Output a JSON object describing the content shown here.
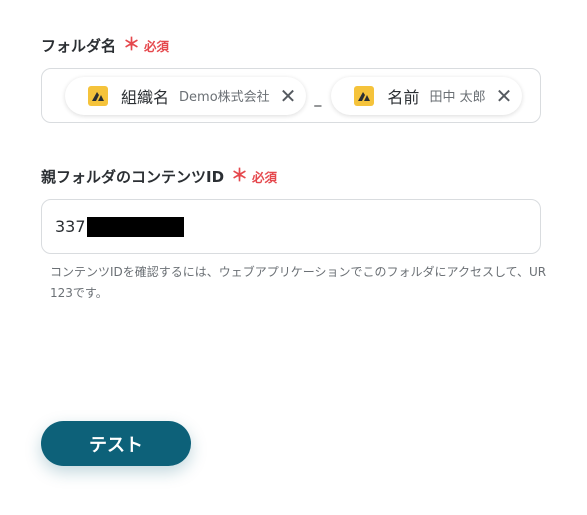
{
  "folder_name_field": {
    "label": "フォルダ名",
    "required_mark": "＊",
    "required_text": "必須",
    "chips": [
      {
        "name": "組織名",
        "value": "Demo株式会社",
        "icon": "app-logo-icon"
      },
      {
        "name": "名前",
        "value": "田中 太郎",
        "icon": "app-logo-icon"
      }
    ],
    "separator": "_"
  },
  "parent_folder_field": {
    "label": "親フォルダのコンテンツID",
    "required_mark": "＊",
    "required_text": "必須",
    "value_visible": "337",
    "helper_line1": "コンテンツIDを確認するには、ウェブアプリケーションでこのフォルダにアクセスして、UR",
    "helper_line2": "123です。"
  },
  "test_button": {
    "label": "テスト",
    "color": "#0d6179"
  },
  "colors": {
    "required": "#e5484d",
    "app_icon": "#f5c33b"
  }
}
